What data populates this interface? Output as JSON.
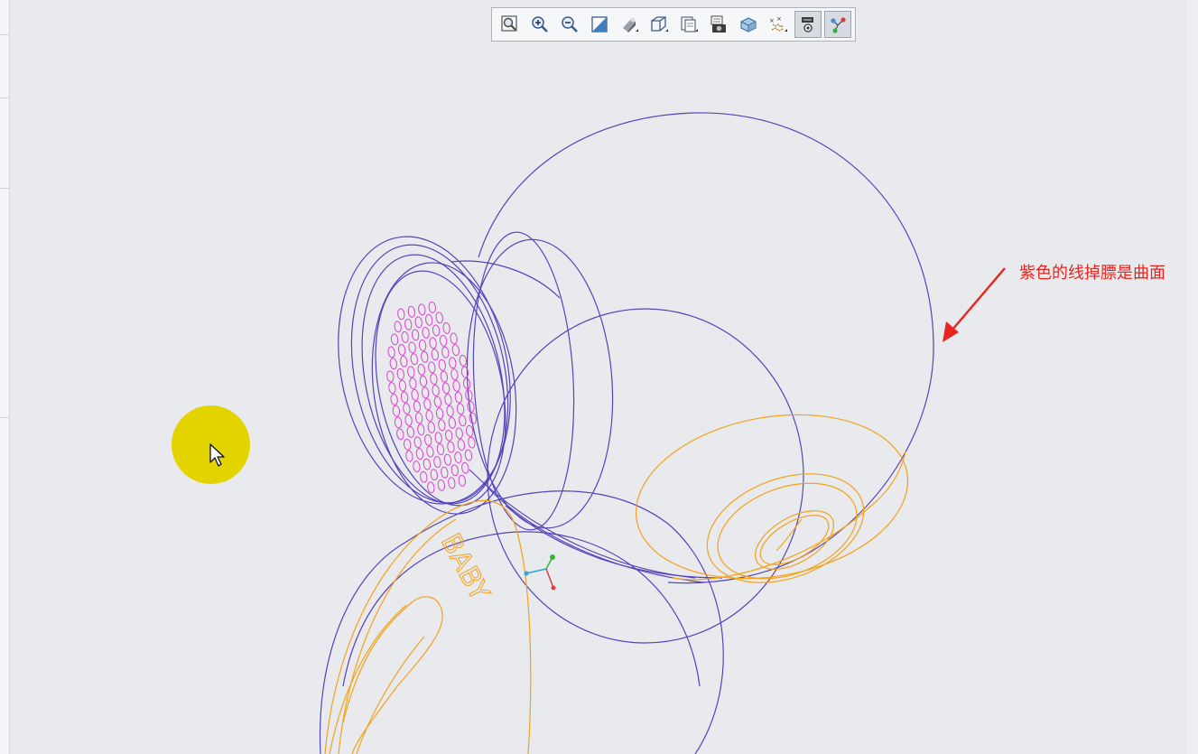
{
  "toolbar": {
    "buttons": [
      {
        "name": "refit-button",
        "icon": "refit-icon"
      },
      {
        "name": "zoom-in-button",
        "icon": "zoom-in-icon"
      },
      {
        "name": "zoom-out-button",
        "icon": "zoom-out-icon"
      },
      {
        "name": "repaint-button",
        "icon": "repaint-icon"
      },
      {
        "name": "display-style-button",
        "icon": "shading-icon"
      },
      {
        "name": "saved-orientations-button",
        "icon": "cube-view-icon"
      },
      {
        "name": "view-manager-button",
        "icon": "view-manager-icon"
      },
      {
        "name": "perspective-button",
        "icon": "camera-icon"
      },
      {
        "name": "section-button",
        "icon": "section-cube-icon"
      },
      {
        "name": "datum-display-button",
        "icon": "datum-points-icon"
      },
      {
        "name": "annotation-display-button",
        "icon": "annotation-display-icon"
      },
      {
        "name": "spin-center-button",
        "icon": "spin-center-icon"
      }
    ]
  },
  "annotation": {
    "text": "紫色的线掉膘是曲面",
    "color": "#e8261f"
  },
  "model": {
    "engraved_text": "BABY",
    "surface_color": "#5544bb",
    "feature_color": "#f4a21a",
    "hole_color": "#e040d0"
  },
  "cursor": {
    "highlight_color": "#e3d400"
  }
}
